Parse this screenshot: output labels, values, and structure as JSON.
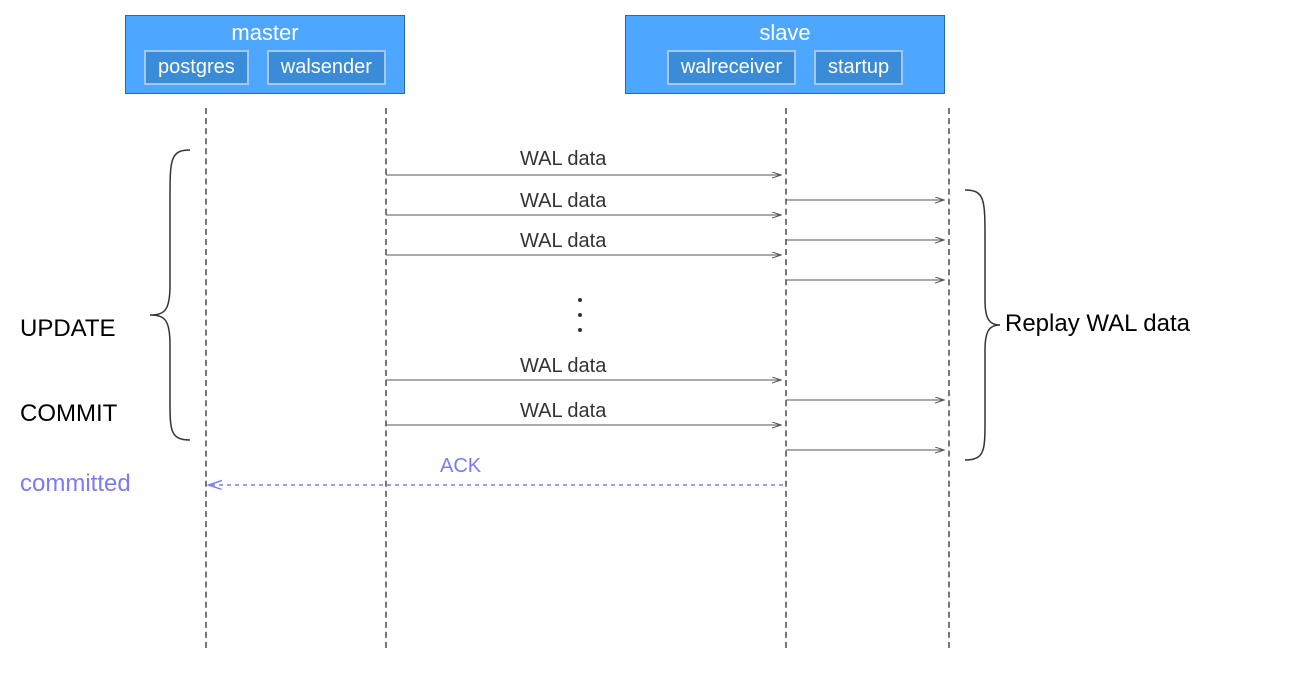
{
  "master": {
    "title": "master",
    "postgres": "postgres",
    "walsender": "walsender"
  },
  "slave": {
    "title": "slave",
    "walreceiver": "walreceiver",
    "startup": "startup"
  },
  "messages": {
    "wal1": "WAL data",
    "wal2": "WAL data",
    "wal3": "WAL data",
    "wal4": "WAL data",
    "wal5": "WAL data",
    "ack": "ACK"
  },
  "labels": {
    "update": "UPDATE",
    "commit": "COMMIT",
    "committed": "committed",
    "replay": "Replay WAL data"
  }
}
